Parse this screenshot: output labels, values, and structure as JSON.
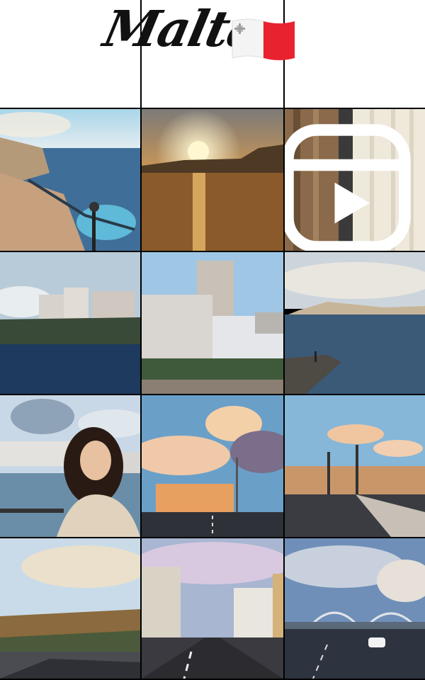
{
  "header": {
    "title": "Malta",
    "flag_icon": "malta-flag-icon"
  },
  "colors": {
    "background": "#000000",
    "header_bg": "#ffffff",
    "flag_red": "#e8232f",
    "title_text": "#111111"
  },
  "grid": {
    "columns": 3,
    "rows": 5
  },
  "posts": [
    {
      "name": "header-left",
      "type": "blank"
    },
    {
      "name": "header-mid",
      "type": "blank"
    },
    {
      "name": "header-right",
      "type": "blank"
    },
    {
      "name": "post-promenade-pool",
      "type": "photo"
    },
    {
      "name": "post-sunset-sea",
      "type": "photo"
    },
    {
      "name": "post-curtain-window",
      "type": "reel"
    },
    {
      "name": "post-bay-apartments",
      "type": "photo"
    },
    {
      "name": "post-tower-buildings",
      "type": "photo"
    },
    {
      "name": "post-coast-pier",
      "type": "photo"
    },
    {
      "name": "post-woman-seafront",
      "type": "photo"
    },
    {
      "name": "post-street-clouds",
      "type": "photo"
    },
    {
      "name": "post-street-lamps",
      "type": "photo"
    },
    {
      "name": "post-highway-cliffs",
      "type": "photo"
    },
    {
      "name": "post-city-road",
      "type": "photo"
    },
    {
      "name": "post-highway-bridge",
      "type": "photo"
    }
  ]
}
